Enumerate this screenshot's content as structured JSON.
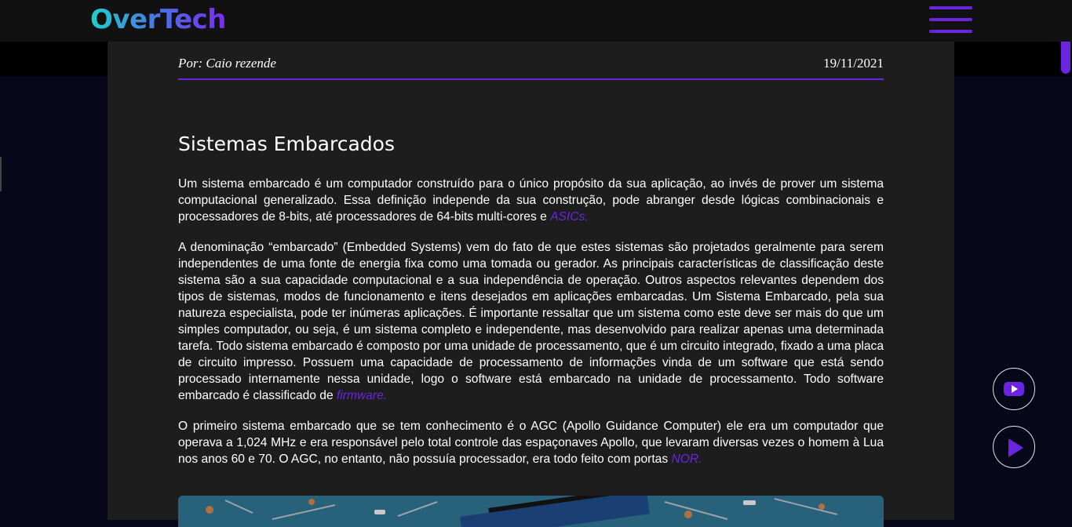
{
  "header": {
    "logo_text": "OverTech",
    "menu_icon": "hamburger-menu-icon",
    "accent_color": "#6b25e0"
  },
  "article": {
    "author": "Por: Caio rezende",
    "date": "19/11/2021",
    "title": "Sistemas Embarcados",
    "p1_text": "Um sistema embarcado é um computador construído para o único propósito da sua aplicação, ao invés de prover um sistema computacional generalizado. Essa definição independe da sua construção, pode abranger desde lógicas combinacionais e processadores de 8-bits, até processadores de 64-bits multi-cores e ",
    "p1_link": "ASICs.",
    "p2_text": "A denominação “embarcado” (Embedded Systems) vem do fato de que estes sistemas são projetados geralmente para serem independentes de uma fonte de energia fixa como uma tomada ou gerador. As principais características de classificação deste sistema são a sua capacidade computacional e a sua independência de operação. Outros aspectos relevantes dependem dos tipos de sistemas, modos de funcionamento e itens desejados em aplicações embarcadas. Um Sistema Embarcado, pela sua natureza especialista, pode ter inúmeras aplicações. É importante ressaltar que um sistema como este deve ser mais do que um simples computador, ou seja, é um sistema completo e independente, mas desenvolvido para realizar apenas uma determinada tarefa. Todo sistema embarcado é composto por uma unidade de processamento, que é um circuito integrado, fixado a uma placa de circuito impresso. Possuem uma capacidade de processamento de informações vinda de um software que está sendo processado internamente nessa unidade, logo o software está embarcado na unidade de processamento. Todo software embarcado é classificado de ",
    "p2_link": "firmware.",
    "p3_text": "O primeiro sistema embarcado que se tem conhecimento é o AGC (Apollo Guidance Computer) ele era um computador que operava a 1,024 MHz e era responsável pelo total controle das espaçonaves Apollo, que levaram diversas vezes o homem à Lua nos anos 60 e 70. O AGC, no entanto, não possuía processador, era todo feito com portas ",
    "p3_link": "NOR."
  },
  "floating_buttons": [
    {
      "icon": "youtube-icon"
    },
    {
      "icon": "play-icon"
    }
  ]
}
